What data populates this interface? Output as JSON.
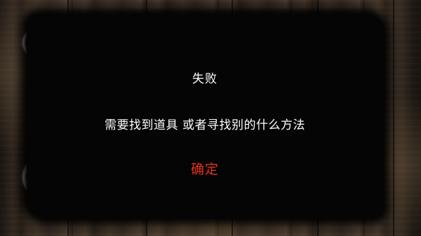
{
  "dialog": {
    "title": "失败",
    "message": "需要找到道具 或者寻找别的什么方法",
    "confirm_label": "确定"
  },
  "colors": {
    "dialog_background": "#050505",
    "text": "#ffffff",
    "confirm_accent": "#e8321c"
  },
  "icons": {
    "background_ring_top": "ring-icon",
    "background_ring_bottom": "ring-icon"
  }
}
